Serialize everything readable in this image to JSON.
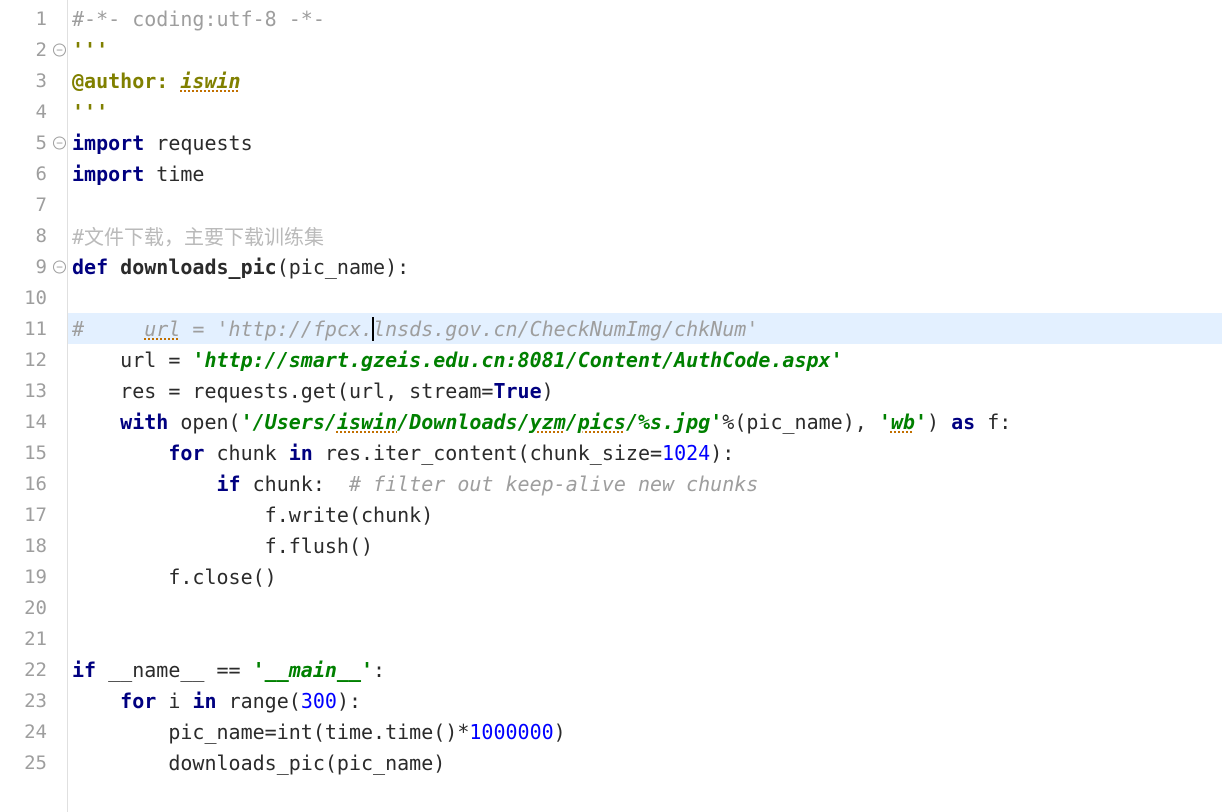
{
  "gutter": {
    "lines": [
      {
        "num": "1",
        "fold": false
      },
      {
        "num": "2",
        "fold": true
      },
      {
        "num": "3",
        "fold": false
      },
      {
        "num": "4",
        "fold": false
      },
      {
        "num": "5",
        "fold": true
      },
      {
        "num": "6",
        "fold": false
      },
      {
        "num": "7",
        "fold": false
      },
      {
        "num": "8",
        "fold": false
      },
      {
        "num": "9",
        "fold": true
      },
      {
        "num": "10",
        "fold": false
      },
      {
        "num": "11",
        "fold": false
      },
      {
        "num": "12",
        "fold": false
      },
      {
        "num": "13",
        "fold": false
      },
      {
        "num": "14",
        "fold": false
      },
      {
        "num": "15",
        "fold": false
      },
      {
        "num": "16",
        "fold": false
      },
      {
        "num": "17",
        "fold": false
      },
      {
        "num": "18",
        "fold": false
      },
      {
        "num": "19",
        "fold": false
      },
      {
        "num": "20",
        "fold": false
      },
      {
        "num": "21",
        "fold": false
      },
      {
        "num": "22",
        "fold": false
      },
      {
        "num": "23",
        "fold": false
      },
      {
        "num": "24",
        "fold": false
      },
      {
        "num": "25",
        "fold": false
      }
    ],
    "fold_glyph": "−"
  },
  "code": {
    "l1": {
      "comment": "#-*- coding:utf-8 -*-"
    },
    "l2": {
      "doc": "'''"
    },
    "l3": {
      "decorator": "@author: ",
      "author": "iswin"
    },
    "l4": {
      "doc": "'''"
    },
    "l5": {
      "kw": "import ",
      "mod": "requests"
    },
    "l6": {
      "kw": "import ",
      "mod": "time"
    },
    "l8": {
      "comment": "#文件下载，主要下载训练集"
    },
    "l9": {
      "kw": "def ",
      "name": "downloads_pic",
      "params": "(pic_name):"
    },
    "l11": {
      "hash": "#     ",
      "url_word": "url",
      "eq": " = ",
      "str_open": "'",
      "url_pre": "http://fpcx.",
      "url_post": "lnsds.gov.cn/CheckNumImg/chkNum",
      "str_close": "'"
    },
    "l12": {
      "indent": "    ",
      "var": "url = ",
      "str": "'http://smart.gzeis.edu.cn:8081/Content/AuthCode.aspx'"
    },
    "l13": {
      "indent": "    ",
      "code": "res = requests.get(url, stream=",
      "true": "True",
      "end": ")"
    },
    "l14": {
      "indent": "    ",
      "kw": "with ",
      "open": "open(",
      "str1": "'/Users/",
      "u1": "iswin",
      "str2": "/Downloads/",
      "u2": "yzm",
      "str3": "/",
      "u3": "pics",
      "str4": "/%s.jpg'",
      "pct": "%(pic_name), ",
      "str5": "'",
      "u4": "wb",
      "str6": "'",
      "end": ") ",
      "kw2": "as ",
      "var": "f:"
    },
    "l15": {
      "indent": "        ",
      "kw": "for ",
      "var": "chunk ",
      "kw2": "in ",
      "code": "res.iter_content(chunk_size=",
      "num": "1024",
      "end": "):"
    },
    "l16": {
      "indent": "            ",
      "kw": "if ",
      "var": "chunk:  ",
      "comment": "# filter out keep-alive new chunks"
    },
    "l17": {
      "indent": "                ",
      "code": "f.write(chunk)"
    },
    "l18": {
      "indent": "                ",
      "code": "f.flush()"
    },
    "l19": {
      "indent": "        ",
      "code": "f.close()"
    },
    "l22": {
      "kw": "if ",
      "var": "__name__ == ",
      "str": "'__main__'",
      "end": ":"
    },
    "l23": {
      "indent": "    ",
      "kw": "for ",
      "var": "i ",
      "kw2": "in ",
      "fn": "range(",
      "num": "300",
      "end": "):"
    },
    "l24": {
      "indent": "        ",
      "code": "pic_name=int(time.time()*",
      "num": "1000000",
      "end": ")"
    },
    "l25": {
      "indent": "        ",
      "code": "downloads_pic(pic_name)"
    }
  }
}
